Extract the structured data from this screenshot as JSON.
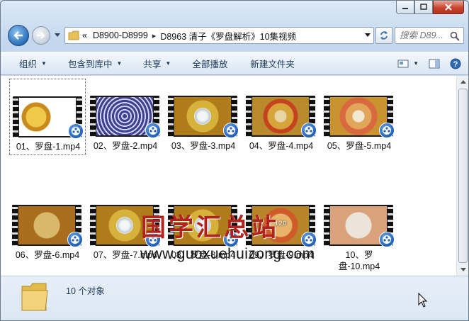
{
  "address_bar": {
    "overflow_mark": "«",
    "crumbs": [
      "D8900-D8999",
      "D8963 清子《罗盘解析》10集视频"
    ]
  },
  "search": {
    "placeholder": "搜索 D89..."
  },
  "toolbar": {
    "organize": "组织",
    "include_in_library": "包含到库中",
    "share": "共享",
    "play_all": "全部播放",
    "new_folder": "新建文件夹"
  },
  "files": [
    {
      "label": "01、罗盘-1.mp4",
      "scene": "compass-yellow"
    },
    {
      "label": "02、罗盘-2.mp4",
      "scene": "ring-blue",
      "caption": ""
    },
    {
      "label": "03、罗盘-3.mp4",
      "scene": "compass-dial"
    },
    {
      "label": "04、罗盘-4.mp4",
      "scene": "compass-red"
    },
    {
      "label": "05、罗盘-5.mp4",
      "scene": "compass-red-light"
    },
    {
      "label": "06、罗盘-6.mp4",
      "scene": "compass-text",
      "caption": ""
    },
    {
      "label": "07、罗盘-7.mp4",
      "scene": "compass-dial"
    },
    {
      "label": "08、罗盘-8.mp4",
      "scene": "compass-dial"
    },
    {
      "label": "09、罗盘-9.mp4",
      "scene": "compass-text-red",
      "caption": "120"
    },
    {
      "label": "10、罗盘-10.mp4",
      "scene": "compass-text-light",
      "caption": ""
    }
  ],
  "watermark": {
    "title": "国学汇总站",
    "url": "www.guoxuehuizong.com"
  },
  "details": {
    "item_count": "10 个对象"
  },
  "colors": {
    "accent": "#1e395b",
    "watermark_red": "#b2221c"
  }
}
